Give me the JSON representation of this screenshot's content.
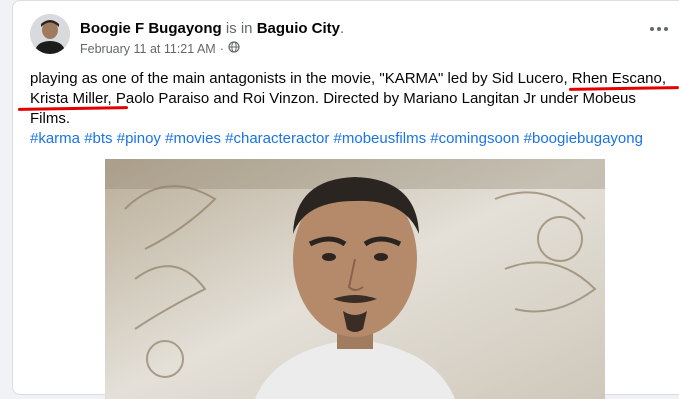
{
  "post": {
    "author": "Boogie F Bugayong",
    "is_in": " is in ",
    "place": "Baguio City",
    "period": ".",
    "timestamp": "February 11 at 11:21 AM",
    "separator": "·",
    "privacy_icon": "globe-icon",
    "more_icon": "more-options-icon",
    "text": {
      "part1": "playing as one of the main antagonists in the movie, \"KARMA\" led by Sid Lucero, ",
      "name1": "Rhen Escano,",
      "space": " ",
      "name2": "Krista Miller,",
      "part2": " Paolo Paraiso and Roi Vinzon. Directed by Mariano Langitan Jr under Mobeus Films."
    },
    "hashtags": [
      "#karma",
      "#bts",
      "#pinoy",
      "#movies",
      "#characteractor",
      "#mobeusfilms",
      "#comingsoon",
      "#boogiebugayong"
    ],
    "annotation_color": "#e30000",
    "hashtag_color": "#1b74e4"
  }
}
